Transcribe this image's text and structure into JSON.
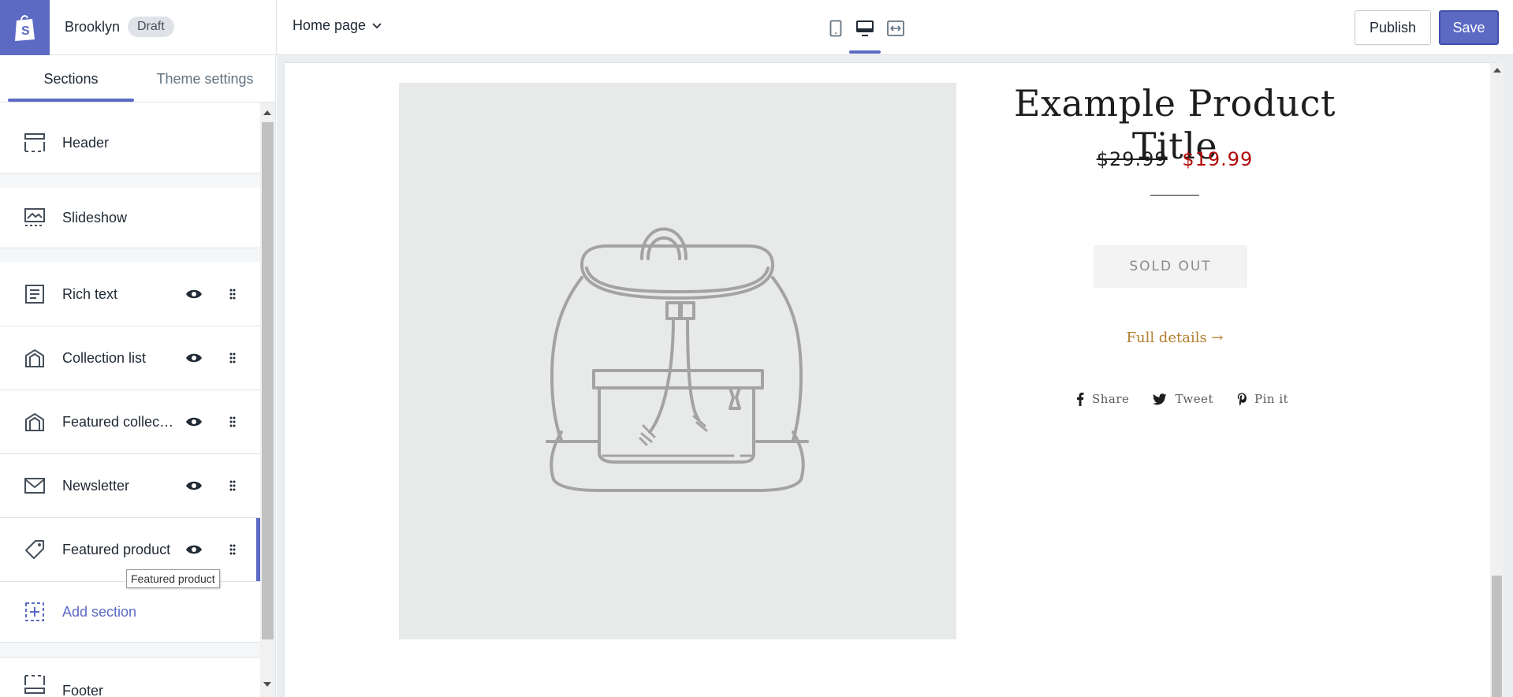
{
  "topbar": {
    "theme_name": "Brooklyn",
    "badge": "Draft",
    "page_select": "Home page",
    "publish_label": "Publish",
    "save_label": "Save",
    "brand_color": "#5c6ac4"
  },
  "sidebar": {
    "tabs": [
      {
        "label": "Sections",
        "active": true
      },
      {
        "label": "Theme settings",
        "active": false
      }
    ],
    "items": [
      {
        "label": "Header",
        "icon": "header-icon"
      },
      {
        "label": "Slideshow",
        "icon": "slideshow-icon"
      },
      {
        "label": "Rich text",
        "icon": "rich-text-icon"
      },
      {
        "label": "Collection list",
        "icon": "collection-icon"
      },
      {
        "label": "Featured collection",
        "icon": "collection-icon"
      },
      {
        "label": "Newsletter",
        "icon": "envelope-icon"
      },
      {
        "label": "Featured product",
        "icon": "tag-icon"
      },
      {
        "label": "Add section",
        "icon": "add-section-icon"
      },
      {
        "label": "Footer",
        "icon": "footer-icon"
      }
    ],
    "tooltip": "Featured product"
  },
  "preview": {
    "product_title": "Example Product Title",
    "price_old": "$29.99",
    "price_new": "$19.99",
    "sold_out": "SOLD OUT",
    "full_details": "Full details →",
    "share": "Share",
    "tweet": "Tweet",
    "pin": "Pin it"
  }
}
